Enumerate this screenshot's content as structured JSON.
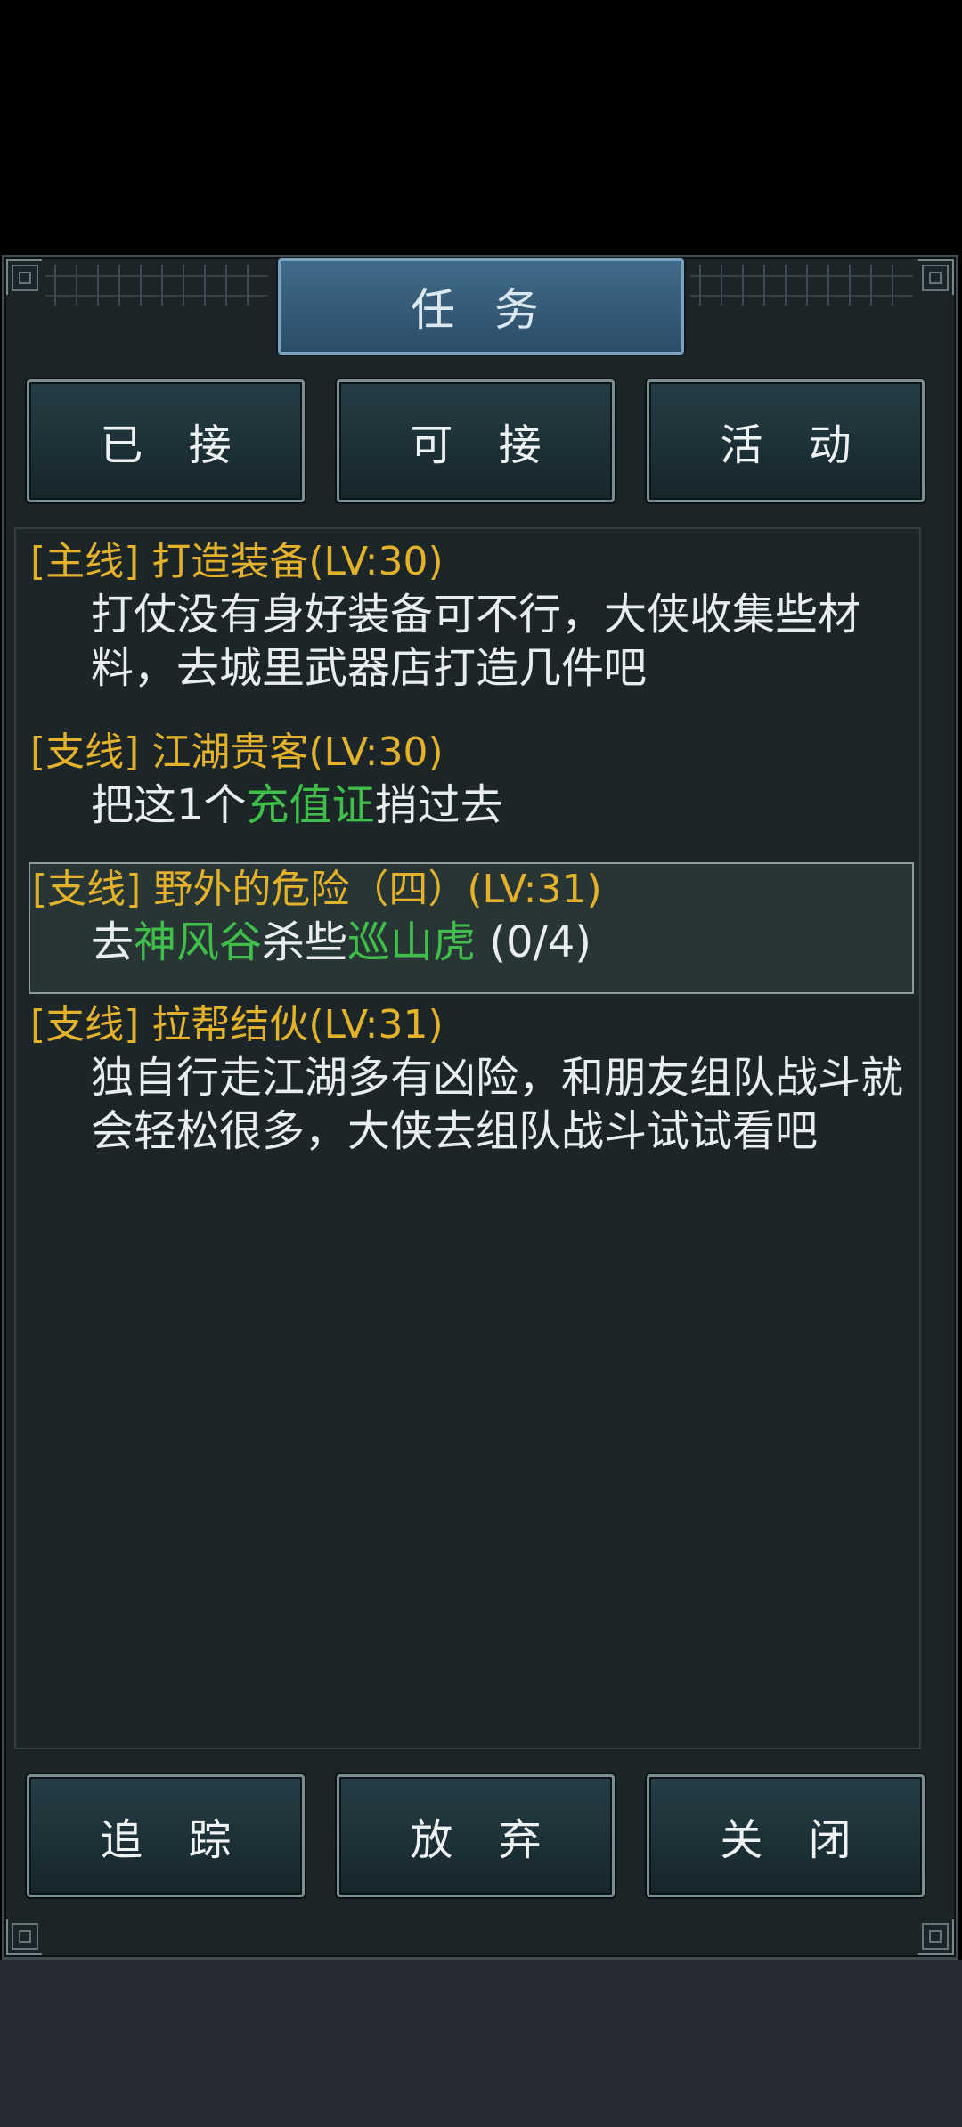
{
  "header": {
    "title": "任 务"
  },
  "tabs": [
    {
      "label": "已 接"
    },
    {
      "label": "可 接"
    },
    {
      "label": "活 动"
    }
  ],
  "quests": [
    {
      "title": "[主线] 打造装备(LV:30)",
      "desc": "打仗没有身好装备可不行，大侠收集些材料，去城里武器店打造几件吧"
    },
    {
      "title": "[支线] 江湖贵客(LV:30)",
      "desc_prefix": "把这1个",
      "desc_item": "充值证",
      "desc_suffix": "捎过去"
    },
    {
      "title": "[支线] 野外的危险（四）(LV:31)",
      "desc_prefix": "去",
      "desc_place": "神风谷",
      "desc_mid": "杀些",
      "desc_target": "巡山虎",
      "desc_progress": " (0/4)"
    },
    {
      "title": "[支线] 拉帮结伙(LV:31)",
      "desc": "独自行走江湖多有凶险，和朋友组队战斗就会轻松很多，大侠去组队战斗试试看吧"
    }
  ],
  "actions": [
    {
      "label": "追 踪"
    },
    {
      "label": "放 弃"
    },
    {
      "label": "关 闭"
    }
  ],
  "colors": {
    "quest_title": "#e3b22a",
    "highlight": "#3fbf49",
    "title_tab": "#2f5674"
  }
}
